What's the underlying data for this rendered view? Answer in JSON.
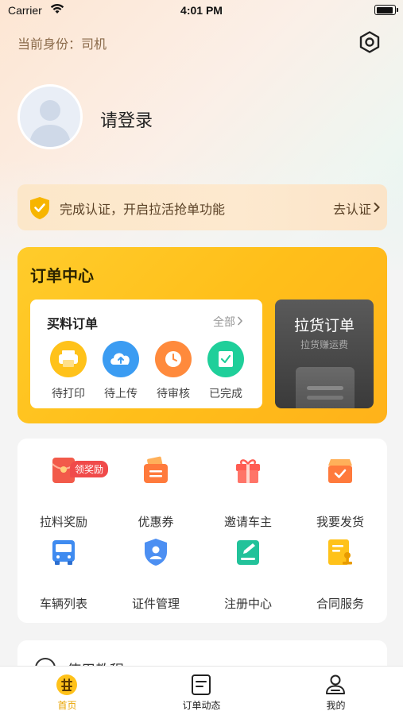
{
  "status_bar": {
    "carrier": "Carrier",
    "time": "4:01 PM"
  },
  "header": {
    "identity": "当前身份：司机",
    "settings_icon": "gear-icon"
  },
  "profile": {
    "login": "请登录",
    "avatar_icon": "default-avatar-icon"
  },
  "auth_banner": {
    "text": "完成认证，开启拉活抢单功能",
    "action": "去认证",
    "accent": "#f7b500"
  },
  "order_center": {
    "title": "订单中心",
    "purchase": {
      "title": "买料订单",
      "all": "全部",
      "items": [
        {
          "label": "待打印",
          "icon": "printer-icon",
          "color": "#ffc21a"
        },
        {
          "label": "待上传",
          "icon": "upload-cloud-icon",
          "color": "#3b9cf2"
        },
        {
          "label": "待审核",
          "icon": "clock-icon",
          "color": "#ff8a3c"
        },
        {
          "label": "已完成",
          "icon": "check-icon",
          "color": "#1fcf9a"
        }
      ]
    },
    "haul": {
      "title": "拉货订单",
      "subtitle": "拉货赚运费"
    }
  },
  "services": {
    "items": [
      {
        "label": "拉料奖励",
        "icon": "red-envelope-icon",
        "badge": "领奖励"
      },
      {
        "label": "优惠券",
        "icon": "coupon-wallet-icon"
      },
      {
        "label": "邀请车主",
        "icon": "gift-icon"
      },
      {
        "label": "我要发货",
        "icon": "shipping-box-icon"
      },
      {
        "label": "车辆列表",
        "icon": "bus-icon"
      },
      {
        "label": "证件管理",
        "icon": "id-card-icon"
      },
      {
        "label": "注册中心",
        "icon": "edit-document-icon"
      },
      {
        "label": "合同服务",
        "icon": "contract-stamp-icon"
      }
    ]
  },
  "tutorial": {
    "text": "使用教程"
  },
  "tabbar": {
    "items": [
      {
        "label": "首页",
        "icon": "home-logo-icon",
        "active": true
      },
      {
        "label": "订单动态",
        "icon": "order-list-icon",
        "active": false
      },
      {
        "label": "我的",
        "icon": "user-icon",
        "active": false
      }
    ]
  }
}
